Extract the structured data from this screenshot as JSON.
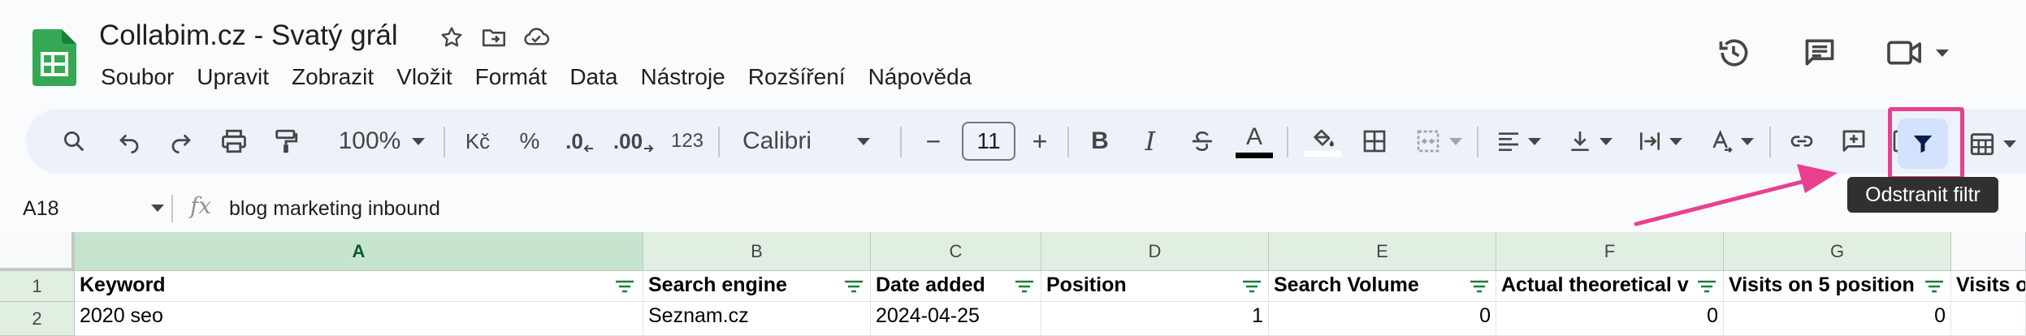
{
  "app": {
    "doc_title": "Collabim.cz - Svatý grál",
    "brand_color": "#34a853",
    "accent_color": "#e8408f"
  },
  "menu": [
    "Soubor",
    "Upravit",
    "Zobrazit",
    "Vložit",
    "Formát",
    "Data",
    "Nástroje",
    "Rozšíření",
    "Nápověda"
  ],
  "toolbar": {
    "zoom": "100%",
    "currency": "Kč",
    "percent": "%",
    "decrease_decimals": ".0",
    "increase_decimals": ".00",
    "number_format": "123",
    "font_family": "Calibri",
    "font_size": "11",
    "minus": "−",
    "plus": "+",
    "bold": "B",
    "italic": "I",
    "text_color_letter": "A",
    "filter_tooltip": "Odstranit filtr"
  },
  "formula_bar": {
    "cell_ref": "A18",
    "fx": "fx",
    "formula": "blog marketing inbound"
  },
  "grid": {
    "columns": [
      "A",
      "B",
      "C",
      "D",
      "E",
      "F",
      "G"
    ],
    "rows": [
      "1",
      "2"
    ],
    "header": [
      "Keyword",
      "Search engine",
      "Date added",
      "Position",
      "Search Volume",
      "Actual theoretical v",
      "Visits on 5 position",
      "Visits o"
    ],
    "row2": [
      "2020 seo",
      "Seznam.cz",
      "2024-04-25",
      "1",
      "0",
      "0",
      "0",
      ""
    ]
  }
}
